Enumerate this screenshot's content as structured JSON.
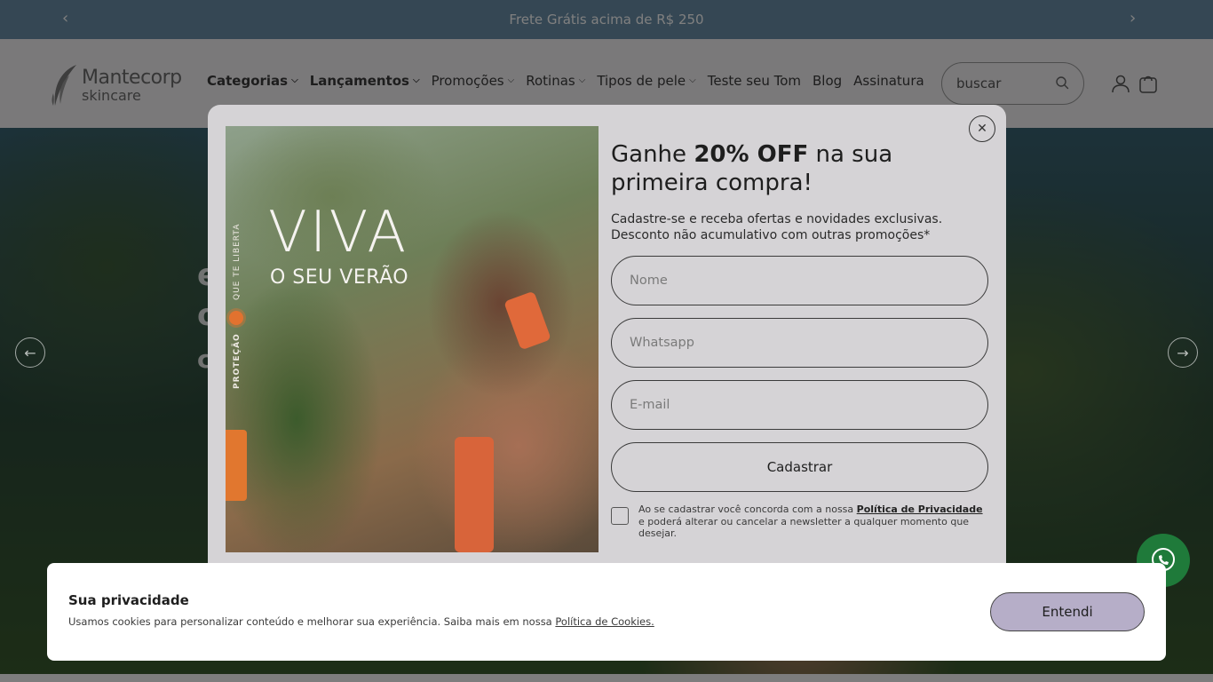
{
  "announcement": {
    "text": "Frete Grátis acima de R$ 250",
    "prev_icon": "chevron-left-icon",
    "next_icon": "chevron-right-icon"
  },
  "header": {
    "logo": {
      "brand": "Mantecorp",
      "sub": "skincare"
    },
    "nav": [
      {
        "label": "Categorias",
        "dropdown": true,
        "bold": true
      },
      {
        "label": "Lançamentos",
        "dropdown": true,
        "bold": true
      },
      {
        "label": "Promoções",
        "dropdown": true,
        "bold": false
      },
      {
        "label": "Rotinas",
        "dropdown": true,
        "bold": false
      },
      {
        "label": "Tipos de pele",
        "dropdown": true,
        "bold": false
      },
      {
        "label": "Teste seu Tom",
        "dropdown": false,
        "bold": false
      },
      {
        "label": "Blog",
        "dropdown": false,
        "bold": false
      },
      {
        "label": "Assinatura",
        "dropdown": false,
        "bold": false
      }
    ],
    "search": {
      "placeholder": "buscar"
    }
  },
  "modal": {
    "image": {
      "title": "VIVA",
      "subtitle": "O SEU VERÃO",
      "tag_top": "QUE TE LIBERTA",
      "tag_bottom": "PROTEÇÃO"
    },
    "headline_pre": "Ganhe ",
    "headline_bold": "20% OFF",
    "headline_post": " na sua primeira compra!",
    "subtext_line1": "Cadastre-se e receba ofertas e novidades exclusivas.",
    "subtext_line2": "Desconto não acumulativo com outras promoções*",
    "fields": {
      "name_placeholder": "Nome",
      "whatsapp_placeholder": "Whatsapp",
      "email_placeholder": "E-mail"
    },
    "submit_label": "Cadastrar",
    "consent_pre": "Ao se cadastrar você concorda com a nossa ",
    "consent_link": "Política de Privacidade",
    "consent_post": " e poderá alterar ou cancelar a newsletter a qualquer momento que desejar."
  },
  "cookie": {
    "title": "Sua privacidade",
    "text": "Usamos cookies para personalizar conteúdo e melhorar sua experiência. Saiba mais em nossa ",
    "link": "Política de Cookies.",
    "button": "Entendi",
    "button_color": "#b6aec8"
  },
  "colors": {
    "announce_bg": "#6b8fa8",
    "header_bg": "#f4f2f5",
    "modal_bg": "#d5d3d6",
    "whatsapp": "#1f7a3a"
  }
}
